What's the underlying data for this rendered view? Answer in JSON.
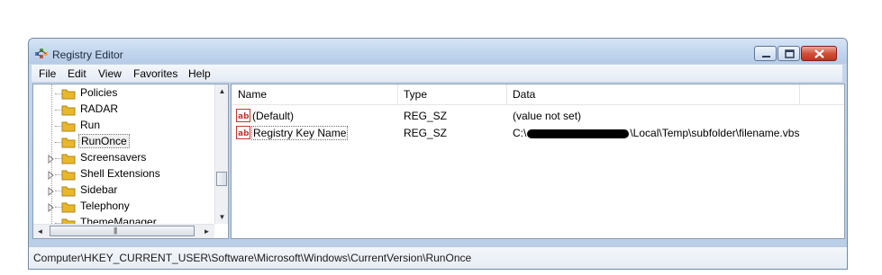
{
  "window": {
    "title": "Registry Editor"
  },
  "menu": [
    "File",
    "Edit",
    "View",
    "Favorites",
    "Help"
  ],
  "tree": {
    "items": [
      {
        "label": "Policies",
        "expandable": false
      },
      {
        "label": "RADAR",
        "expandable": false
      },
      {
        "label": "Run",
        "expandable": false
      },
      {
        "label": "RunOnce",
        "expandable": false,
        "selected": true
      },
      {
        "label": "Screensavers",
        "expandable": true
      },
      {
        "label": "Shell Extensions",
        "expandable": true
      },
      {
        "label": "Sidebar",
        "expandable": true
      },
      {
        "label": "Telephony",
        "expandable": true
      },
      {
        "label": "ThemeManager",
        "expandable": false
      }
    ]
  },
  "list": {
    "columns": [
      "Name",
      "Type",
      "Data"
    ],
    "rows": [
      {
        "name": "(Default)",
        "type": "REG_SZ",
        "data": "(value not set)"
      },
      {
        "name": "Registry Key Name",
        "type": "REG_SZ",
        "data_prefix": "C:\\",
        "data_suffix": "\\Local\\Temp\\subfolder\\filename.vbs",
        "redacted": true
      }
    ]
  },
  "status": {
    "path": "Computer\\HKEY_CURRENT_USER\\Software\\Microsoft\\Windows\\CurrentVersion\\RunOnce"
  },
  "colors": {
    "accent": "#c2d5ee",
    "close": "#c0341e",
    "folder": "#e8b82a"
  }
}
